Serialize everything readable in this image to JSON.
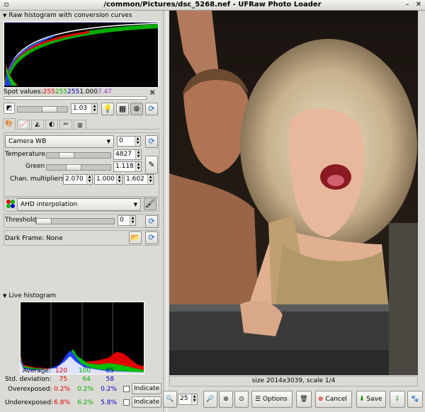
{
  "window": {
    "title": "/common/Pictures/dsc_5268.nef - UFRaw Photo Loader"
  },
  "raw_histogram": {
    "heading": "Raw histogram with conversion curves"
  },
  "spot_values": {
    "label": "Spot values:",
    "r": "255",
    "g": "255",
    "b": "255",
    "v": "1.000",
    "extra": "7.47"
  },
  "exposure": {
    "value": "1.03"
  },
  "white_balance": {
    "mode": "Camera WB",
    "fine_tune": "0",
    "temperature_label": "Temperature",
    "temperature_value": "4827",
    "green_label": "Green",
    "green_value": "1.118",
    "multipliers_label": "Chan. multipliers",
    "mult_r": "2.070",
    "mult_g": "1.000",
    "mult_b": "1.602"
  },
  "interpolation": {
    "mode": "AHD interpolation"
  },
  "threshold": {
    "label": "Threshold",
    "value": "0"
  },
  "dark_frame": {
    "label": "Dark Frame:",
    "value": "None"
  },
  "live_histogram": {
    "heading": "Live histogram",
    "average_label": "Average:",
    "avg_r": "120",
    "avg_g": "100",
    "avg_b": "85",
    "std_label": "Std. deviation:",
    "std_r": "75",
    "std_g": "64",
    "std_b": "58",
    "over_label": "Overexposed:",
    "over_r": "0.2%",
    "over_g": "0.2%",
    "over_b": "0.2%",
    "under_label": "Underexposed:",
    "under_r": "6.8%",
    "under_g": "6.2%",
    "under_b": "5.8%",
    "indicate_label": "Indicate"
  },
  "preview": {
    "status": "size 2014x3039, scale 1/4"
  },
  "toolbar": {
    "zoom_value": "25",
    "options_label": "Options",
    "cancel_label": "Cancel",
    "save_label": "Save"
  },
  "colors": {
    "red": "#e00000",
    "green": "#00b000",
    "blue": "#0000c0",
    "purple": "#9040c0"
  }
}
